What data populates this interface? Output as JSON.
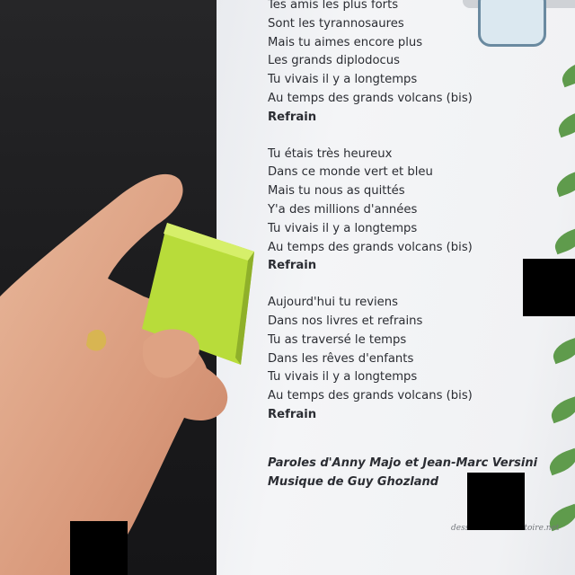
{
  "scene": {
    "description_colors": {
      "paper": "#f2f3f5",
      "text": "#2b2d33",
      "leaf": "#5f9b4c",
      "cube": "#b8dc3a"
    }
  },
  "sheet": {
    "top_label": "",
    "stanza1": [
      "Tes amis les plus forts",
      "Sont les tyrannosaures",
      "Mais tu aimes encore plus",
      "Les grands diplodocus",
      "Tu vivais il y a longtemps",
      "Au temps des grands volcans (bis)"
    ],
    "refrain1": "Refrain",
    "stanza2": [
      "Tu étais très heureux",
      "Dans ce monde vert et bleu",
      "Mais tu nous as quittés",
      "Y'a des millions d'années",
      "Tu vivais il y a longtemps",
      "Au temps des grands volcans (bis)"
    ],
    "refrain2": "Refrain",
    "stanza3": [
      "Aujourd'hui tu reviens",
      "Dans nos livres et refrains",
      "Tu as traversé le temps",
      "Dans les rêves d'enfants",
      "Tu vivais il y a longtemps",
      "Au temps des grands volcans (bis)"
    ],
    "refrain3": "Refrain",
    "credits": [
      "Paroles d'Anny Majo et Jean-Marc Versini",
      "Musique de Guy Ghozland"
    ],
    "site": "dessinemoiunehistoire.net"
  }
}
